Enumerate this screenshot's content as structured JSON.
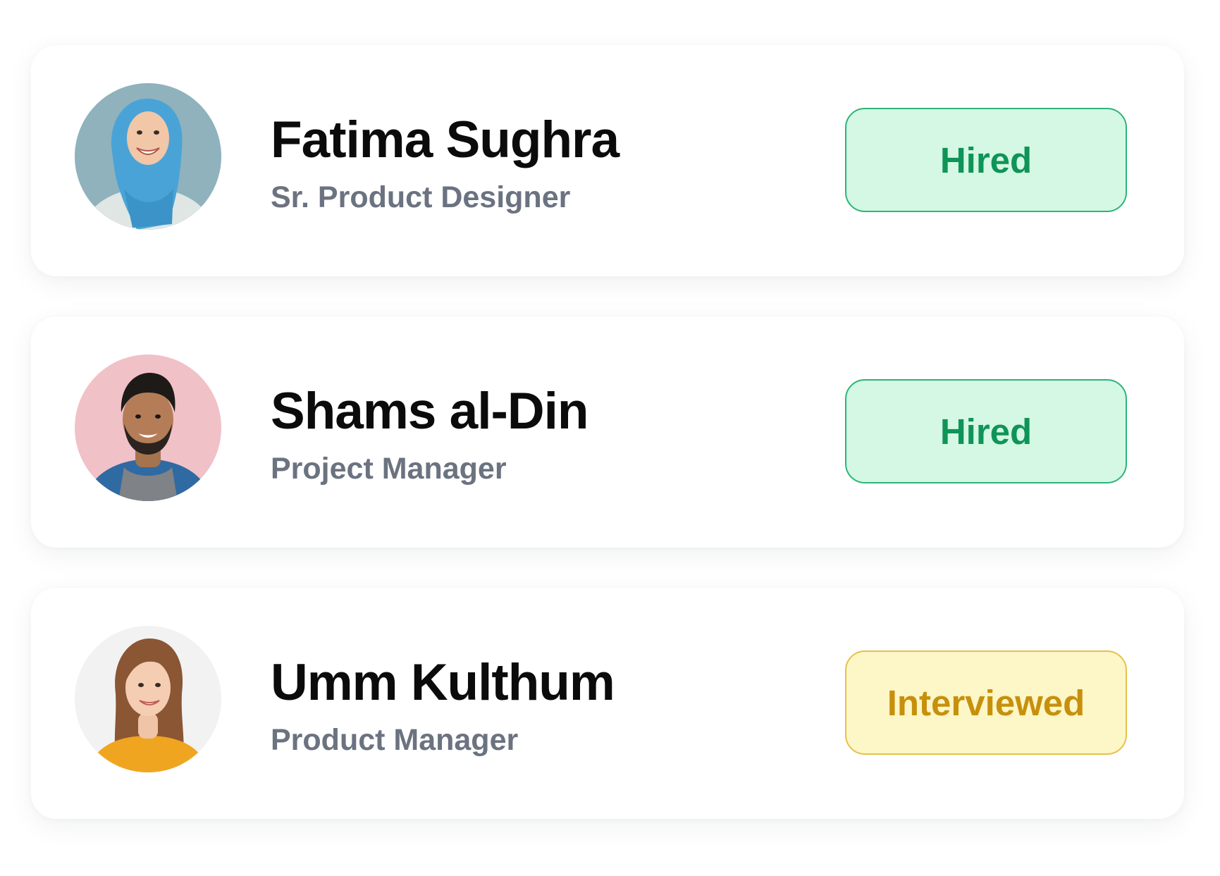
{
  "candidates": [
    {
      "name": "Fatima Sughra",
      "role": "Sr. Product Designer",
      "status": "Hired",
      "status_colors": {
        "bg": "#d4f8e4",
        "border": "#2fb37a",
        "text": "#0f9458"
      },
      "avatar_bg": "#8fb2bd"
    },
    {
      "name": "Shams al-Din",
      "role": "Project Manager",
      "status": "Hired",
      "status_colors": {
        "bg": "#d4f8e4",
        "border": "#2fb37a",
        "text": "#0f9458"
      },
      "avatar_bg": "#f1c1c8"
    },
    {
      "name": "Umm Kulthum",
      "role": "Product Manager",
      "status": "Interviewed",
      "status_colors": {
        "bg": "#fdf6c6",
        "border": "#e5c24a",
        "text": "#c7900c"
      },
      "avatar_bg": "#f2f2f2"
    }
  ]
}
